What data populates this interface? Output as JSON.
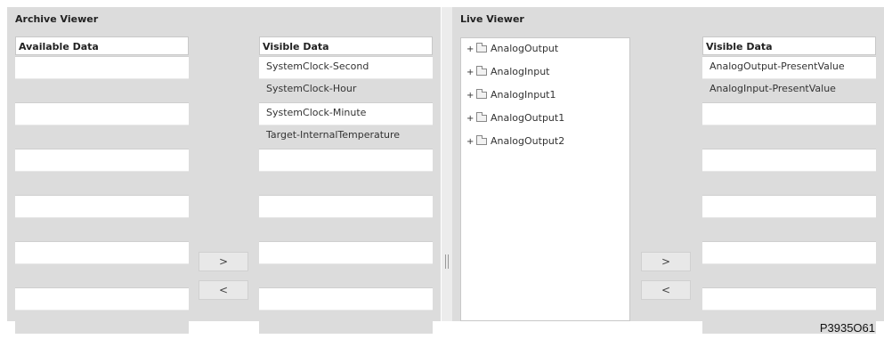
{
  "archive": {
    "title": "Archive Viewer",
    "available_header": "Available Data",
    "available_items": [
      "",
      "",
      "",
      "",
      "",
      "",
      "",
      "",
      "",
      "",
      "",
      ""
    ],
    "visible_header": "Visible Data",
    "visible_items": [
      "SystemClock-Second",
      "SystemClock-Hour",
      "SystemClock-Minute",
      "Target-InternalTemperature",
      "",
      "",
      "",
      "",
      "",
      "",
      "",
      ""
    ],
    "add_label": ">",
    "remove_label": "<"
  },
  "live": {
    "title": "Live Viewer",
    "tree_items": [
      {
        "expander": "+",
        "label": "AnalogOutput"
      },
      {
        "expander": "+",
        "label": "AnalogInput"
      },
      {
        "expander": "+",
        "label": "AnalogInput1"
      },
      {
        "expander": "+",
        "label": "AnalogOutput1"
      },
      {
        "expander": "+",
        "label": "AnalogOutput2"
      }
    ],
    "visible_header": "Visible Data",
    "visible_items": [
      "AnalogOutput-PresentValue",
      "AnalogInput-PresentValue",
      "",
      "",
      "",
      "",
      "",
      "",
      "",
      "",
      "",
      ""
    ],
    "add_label": ">",
    "remove_label": "<"
  },
  "figure_code": "P3935O61"
}
